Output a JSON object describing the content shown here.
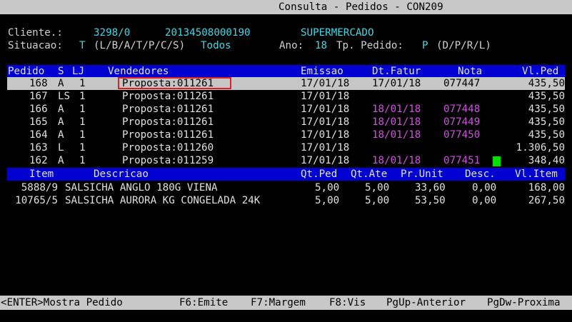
{
  "window": {
    "title": "Consulta - Pedidos - CON209"
  },
  "header": {
    "cliente_label": "Cliente.:",
    "cliente_code": "3298/0",
    "cliente_cnpj": "20134508000190",
    "cliente_name": "SUPERMERCADO",
    "situacao_label": "Situacao:",
    "situacao_value": "T",
    "situacao_options": "(L/B/A/T/P/C/S)",
    "situacao_desc": "Todos",
    "ano_label": "Ano:",
    "ano_value": "18",
    "tp_label": "Tp. Pedido:",
    "tp_value": "P",
    "tp_options": "(D/P/R/L)"
  },
  "orders": {
    "headers": {
      "pedido": "Pedido",
      "s": "S",
      "lj": "LJ",
      "vendedores": "Vendedores",
      "emissao": "Emissao",
      "dt_fatur": "Dt.Fatur",
      "nota": "Nota",
      "vl_ped": "Vl.Ped"
    },
    "rows": [
      {
        "pedido": "168",
        "s": "A",
        "lj": "1",
        "vendedor": "Proposta:011261",
        "emissao": "17/01/18",
        "dt_fatur": "17/01/18",
        "nota": "077447",
        "vl_ped": "435,50"
      },
      {
        "pedido": "167",
        "s": "LS",
        "lj": "1",
        "vendedor": "Proposta:011261",
        "emissao": "17/01/18",
        "dt_fatur": "",
        "nota": "",
        "vl_ped": "435,50"
      },
      {
        "pedido": "166",
        "s": "A",
        "lj": "1",
        "vendedor": "Proposta:011261",
        "emissao": "17/01/18",
        "dt_fatur": "18/01/18",
        "nota": "077448",
        "vl_ped": "435,50"
      },
      {
        "pedido": "165",
        "s": "A",
        "lj": "1",
        "vendedor": "Proposta:011261",
        "emissao": "17/01/18",
        "dt_fatur": "18/01/18",
        "nota": "077449",
        "vl_ped": "435,50"
      },
      {
        "pedido": "164",
        "s": "A",
        "lj": "1",
        "vendedor": "Proposta:011261",
        "emissao": "17/01/18",
        "dt_fatur": "18/01/18",
        "nota": "077450",
        "vl_ped": "435,50"
      },
      {
        "pedido": "163",
        "s": "L",
        "lj": "1",
        "vendedor": "Proposta:011260",
        "emissao": "17/01/18",
        "dt_fatur": "",
        "nota": "",
        "vl_ped": "1.306,50"
      },
      {
        "pedido": "162",
        "s": "A",
        "lj": "1",
        "vendedor": "Proposta:011259",
        "emissao": "17/01/18",
        "dt_fatur": "18/01/18",
        "nota": "077451",
        "vl_ped": "348,40"
      }
    ]
  },
  "items": {
    "headers": {
      "item": "Item",
      "descricao": "Descricao",
      "qt_ped": "Qt.Ped",
      "qt_ate": "Qt.Ate",
      "pr_unit": "Pr.Unit",
      "desc": "Desc.",
      "vl_item": "Vl.Item"
    },
    "rows": [
      {
        "item": "5888/9",
        "descricao": "SALSICHA ANGLO 180G VIENA",
        "qt_ped": "5,00",
        "qt_ate": "5,00",
        "pr_unit": "33,60",
        "desc": "0,00",
        "vl_item": "168,00"
      },
      {
        "item": "10765/5",
        "descricao": "SALSICHA AURORA KG CONGELADA 24K",
        "qt_ped": "5,00",
        "qt_ate": "5,00",
        "pr_unit": "53,50",
        "desc": "0,00",
        "vl_item": "267,50"
      }
    ]
  },
  "footer": {
    "enter": "<ENTER>Mostra Pedido",
    "f6": "F6:Emite",
    "f7": "F7:Margem",
    "f8": "F8:Vis",
    "pgup": "PgUp-Anterior",
    "pgdw": "PgDw-Proxima"
  },
  "colors": {
    "background": "#000000",
    "header_bar": "#0000d0",
    "selected_row": "#c6c6c6",
    "cyan_values": "#3fd7e6",
    "magenta_invoiced": "#d050e0",
    "highlight_box": "#e02020",
    "green_marker": "#00e000"
  }
}
